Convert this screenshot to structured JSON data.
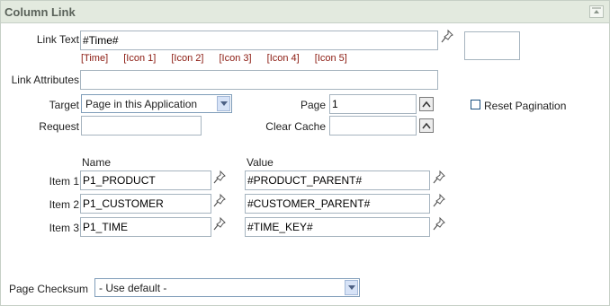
{
  "panel": {
    "title": "Column Link",
    "collapse_icon": "collapse-up-icon"
  },
  "link_text": {
    "label": "Link Text",
    "value": "#Time#",
    "shortcuts": [
      "[Time]",
      "[Icon 1]",
      "[Icon 2]",
      "[Icon 3]",
      "[Icon 4]",
      "[Icon 5]"
    ]
  },
  "link_attributes": {
    "label": "Link Attributes",
    "value": ""
  },
  "target": {
    "label": "Target",
    "value": "Page in this Application"
  },
  "page": {
    "label": "Page",
    "value": "1"
  },
  "reset_pagination": {
    "label": "Reset Pagination",
    "checked": false
  },
  "request": {
    "label": "Request",
    "value": ""
  },
  "clear_cache": {
    "label": "Clear Cache",
    "value": ""
  },
  "items_table": {
    "name_header": "Name",
    "value_header": "Value",
    "rows": [
      {
        "label": "Item 1",
        "name": "P1_PRODUCT",
        "value": "#PRODUCT_PARENT#"
      },
      {
        "label": "Item 2",
        "name": "P1_CUSTOMER",
        "value": "#CUSTOMER_PARENT#"
      },
      {
        "label": "Item 3",
        "name": "P1_TIME",
        "value": "#TIME_KEY#"
      }
    ]
  },
  "page_checksum": {
    "label": "Page Checksum",
    "value": "- Use default -"
  },
  "icons": {
    "pin": "pin-icon",
    "lov": "lov-popup-icon",
    "dropdown": "chevron-down-icon"
  }
}
